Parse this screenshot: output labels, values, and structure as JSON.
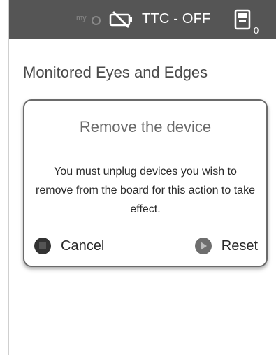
{
  "status_bar": {
    "myq_label": "my",
    "ttc_status": "TTC - OFF",
    "device_count": "0"
  },
  "page": {
    "title": "Monitored Eyes and Edges"
  },
  "dialog": {
    "title": "Remove the device",
    "message": "You must unplug devices you wish to remove from the board for this action to take effect.",
    "cancel_label": "Cancel",
    "reset_label": "Reset"
  }
}
